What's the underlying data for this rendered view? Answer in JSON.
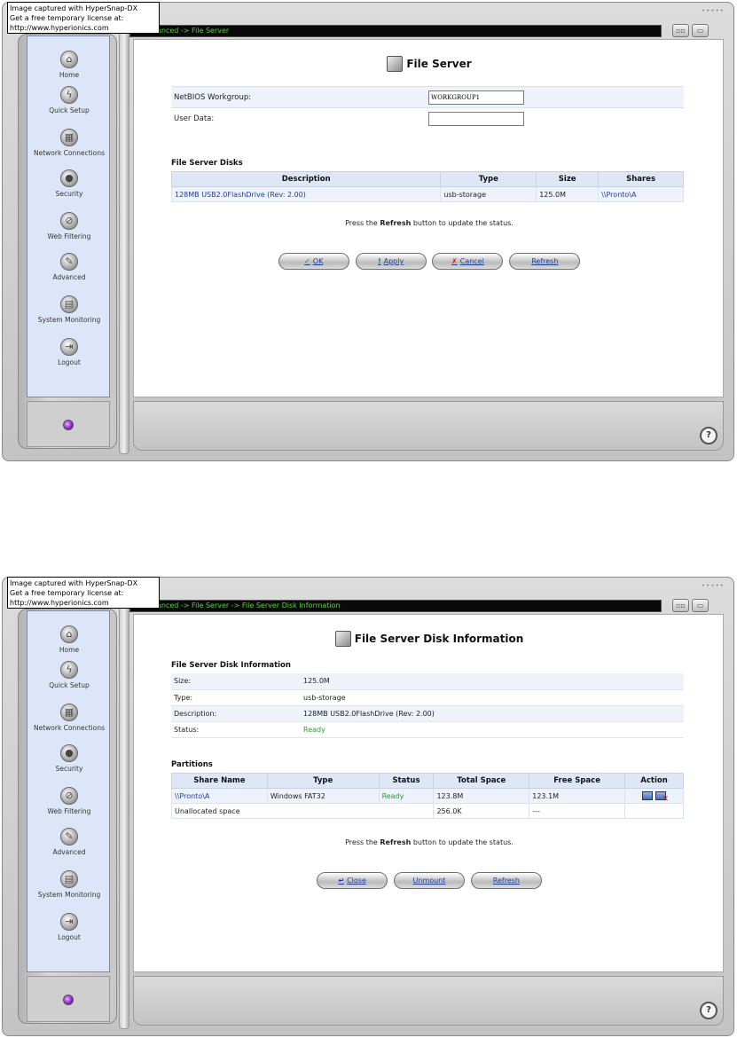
{
  "watermark": {
    "line1": "Image captured with HyperSnap-DX",
    "line2": "Get a free temporary license at:",
    "line3": "http://www.hyperionics.com"
  },
  "sidebar": {
    "items": [
      {
        "label": "Home",
        "icon": "home-icon"
      },
      {
        "label": "Quick Setup",
        "icon": "lightning-icon"
      },
      {
        "label": "Network Connections",
        "icon": "network-icon"
      },
      {
        "label": "Security",
        "icon": "lock-icon"
      },
      {
        "label": "Web Filtering",
        "icon": "filter-icon"
      },
      {
        "label": "Advanced",
        "icon": "tools-icon"
      },
      {
        "label": "System Monitoring",
        "icon": "monitor-icon"
      },
      {
        "label": "Logout",
        "icon": "logout-icon"
      }
    ]
  },
  "shot1": {
    "breadcrumb": "anced -> File Server",
    "title": "File Server",
    "form": {
      "netbios_label": "NetBIOS Workgroup:",
      "netbios_value": "WORKGROUP1",
      "userdata_label": "User Data:",
      "userdata_value": ""
    },
    "disks_title": "File Server Disks",
    "disks_headers": [
      "Description",
      "Type",
      "Size",
      "Shares"
    ],
    "disks_rows": [
      {
        "description": "128MB USB2.0FlashDrive (Rev: 2.00)",
        "type": "usb-storage",
        "size": "125.0M",
        "shares": "\\\\Pronto\\A"
      }
    ],
    "note_pre": "Press the ",
    "note_bold": "Refresh",
    "note_post": " button to update the status.",
    "buttons": {
      "ok": "OK",
      "apply": "Apply",
      "cancel": "Cancel",
      "refresh": "Refresh"
    }
  },
  "shot2": {
    "breadcrumb": "anced -> File Server -> File Server Disk Information",
    "title": "File Server Disk Information",
    "info_title": "File Server Disk Information",
    "info": [
      {
        "key": "Size:",
        "value": "125.0M"
      },
      {
        "key": "Type:",
        "value": "usb-storage"
      },
      {
        "key": "Description:",
        "value": "128MB USB2.0FlashDrive (Rev: 2.00)"
      },
      {
        "key": "Status:",
        "value": "Ready"
      }
    ],
    "partitions_title": "Partitions",
    "partitions_headers": [
      "Share Name",
      "Type",
      "Status",
      "Total Space",
      "Free Space",
      "Action"
    ],
    "partitions_rows": [
      {
        "share": "\\\\Pronto\\A",
        "type": "Windows FAT32",
        "status": "Ready",
        "total": "123.8M",
        "free": "123.1M"
      },
      {
        "share": "Unallocated space",
        "type": "",
        "status": "",
        "total": "256.0K",
        "free": "---"
      }
    ],
    "note_pre": "Press the ",
    "note_bold": "Refresh",
    "note_post": " button to update the status.",
    "buttons": {
      "close": "Close",
      "unmount": "Unmount",
      "refresh": "Refresh"
    }
  },
  "colors": {
    "breadcrumb_text": "#5ad13c",
    "link": "#1f3f9a",
    "ready": "#2f9a2a",
    "sidebar_bg": "#dde6f8"
  }
}
